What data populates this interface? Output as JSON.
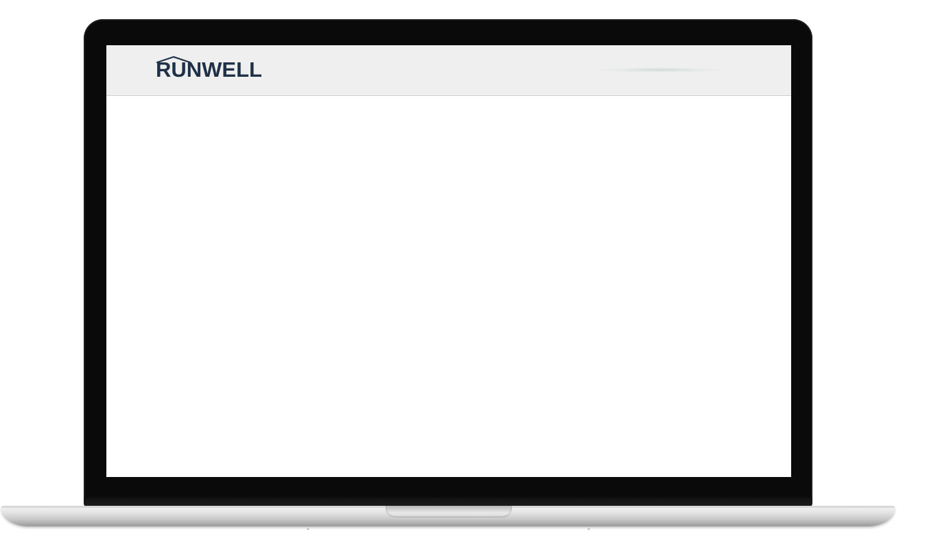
{
  "site": {
    "brand": "RUNWELL"
  },
  "colors": {
    "brand_text": "#1f3147",
    "header_background": "#efefef",
    "page_background": "#ffffff",
    "bezel": "#0a0a0a"
  },
  "icons": {
    "logo_roof": "roof-line-icon"
  }
}
